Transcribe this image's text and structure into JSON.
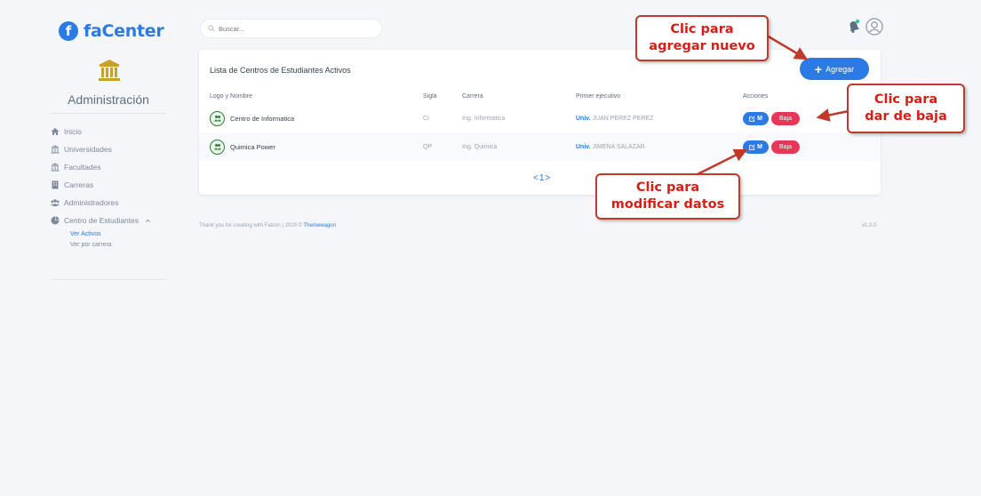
{
  "brand": {
    "initial": "f",
    "name": "faCenter"
  },
  "sidebar": {
    "title": "Administración",
    "items": [
      {
        "label": "Inicio",
        "icon": "home-icon"
      },
      {
        "label": "Universidades",
        "icon": "university-icon"
      },
      {
        "label": "Facultades",
        "icon": "university-icon"
      },
      {
        "label": "Carreras",
        "icon": "building-icon"
      },
      {
        "label": "Administradores",
        "icon": "users-icon"
      },
      {
        "label": "Centro de Estudiantes",
        "icon": "pie-chart-icon"
      }
    ],
    "subitems": [
      {
        "label": "Ver Activos",
        "active": true
      },
      {
        "label": "Ver por carrera",
        "active": false
      }
    ]
  },
  "search": {
    "placeholder": "Buscar..."
  },
  "card": {
    "title": "Lista de Centros de Estudiantes Activos",
    "add_label": "Agregar",
    "columns": [
      "Logo y Nombre",
      "Sigla",
      "Carrera",
      "Primer ejecutivo",
      "Acciones"
    ],
    "rows": [
      {
        "name": "Centro de Informatica",
        "sigla": "CI",
        "carrera": "Ing. Informatica",
        "exec_prefix": "Univ.",
        "exec_name": "JUAN PEREZ PEREZ"
      },
      {
        "name": "Quimica Power",
        "sigla": "QP",
        "carrera": "Ing. Quimica",
        "exec_prefix": "Univ.",
        "exec_name": "JIMENA SALAZAR"
      }
    ],
    "modify_label": "M",
    "delete_label": "Baja",
    "pager": "<1>"
  },
  "footer": {
    "text": "Thank you for creating with Falcon | 2019 © ",
    "link": "Themewagon",
    "version": "v1.0.0"
  },
  "callouts": {
    "add": [
      "Clic para",
      "agregar nuevo"
    ],
    "delete": [
      "Clic para",
      "dar de baja"
    ],
    "modify": [
      "Clic para",
      "modificar datos"
    ]
  },
  "colors": {
    "primary": "#2c7be5",
    "danger": "#e63757",
    "callout_red": "#d91e18"
  }
}
